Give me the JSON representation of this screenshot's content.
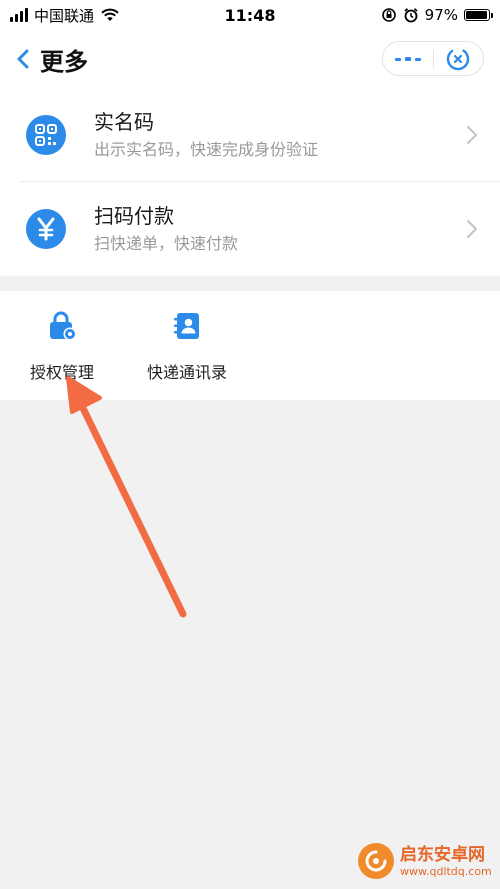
{
  "status_bar": {
    "carrier": "中国联通",
    "time": "11:48",
    "battery": "97%",
    "battery_level": 0.97
  },
  "nav": {
    "title": "更多"
  },
  "services": [
    {
      "title": "实名码",
      "subtitle": "出示实名码，快速完成身份验证",
      "icon": "qr-code-icon"
    },
    {
      "title": "扫码付款",
      "subtitle": "扫快递单，快速付款",
      "icon": "yen-icon"
    }
  ],
  "tools": [
    {
      "label": "授权管理",
      "icon": "lock-gear-icon"
    },
    {
      "label": "快递通讯录",
      "icon": "contact-book-icon"
    }
  ],
  "watermark": {
    "name": "启东安卓网",
    "url": "www.qdltdq.com"
  },
  "colors": {
    "accent": "#2c8be8",
    "annotation_arrow": "#f26b43",
    "background": "#f1f1f1"
  }
}
